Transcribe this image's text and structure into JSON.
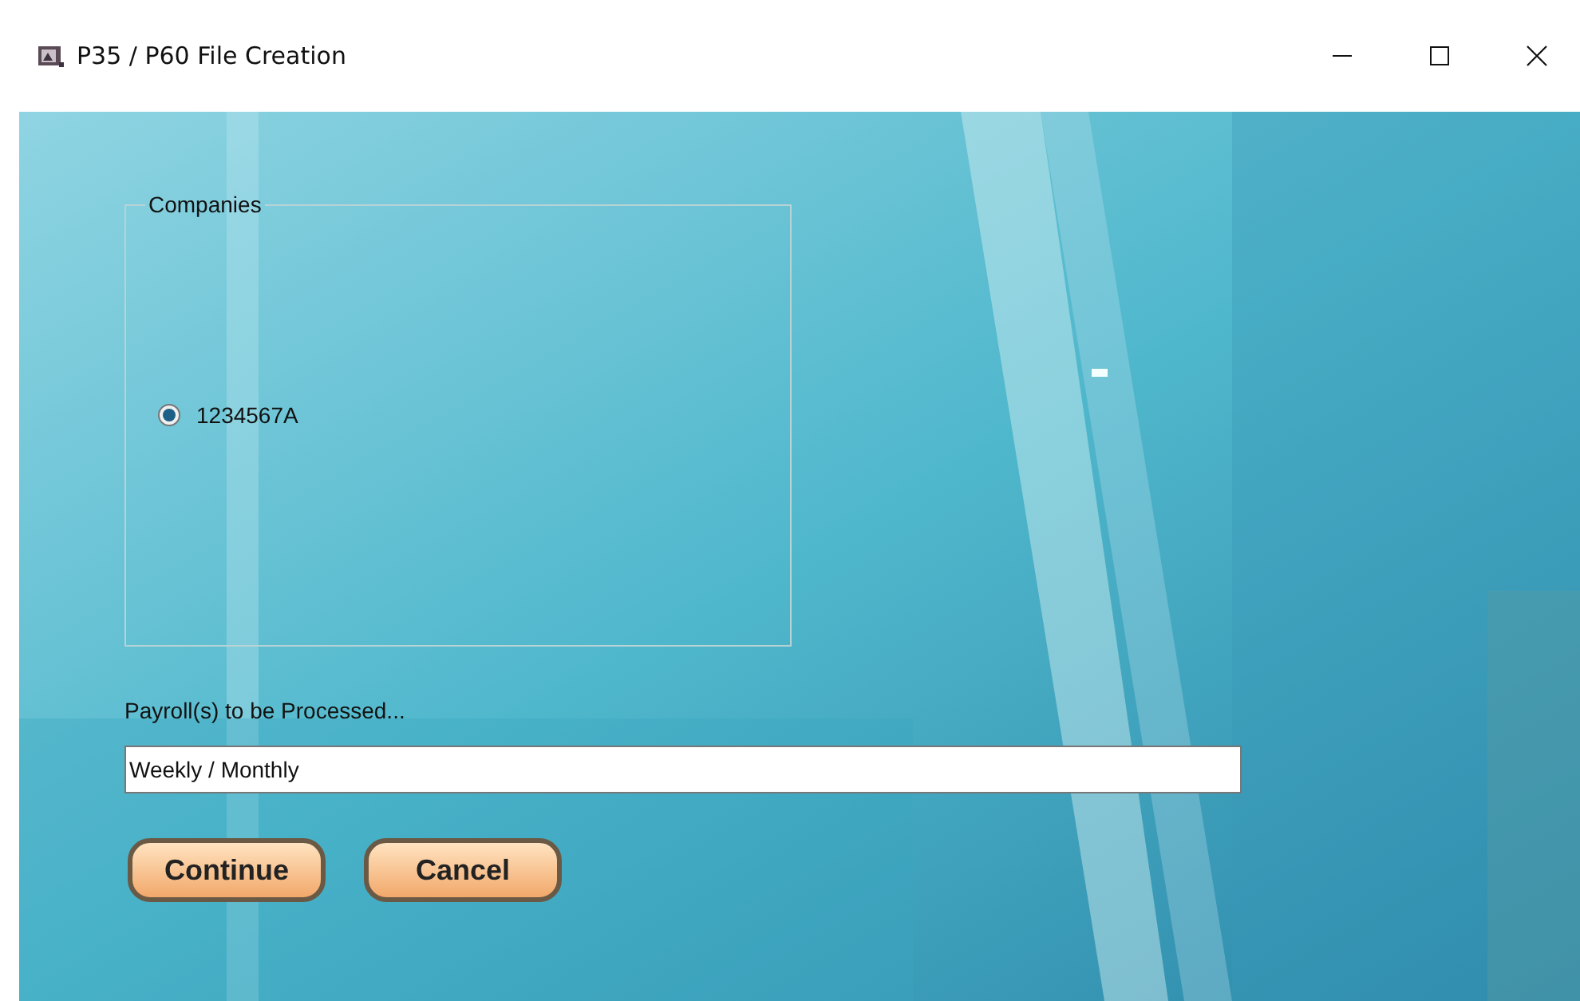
{
  "window": {
    "title": "P35 / P60 File Creation"
  },
  "companies": {
    "title": "Companies",
    "items": [
      {
        "label": "1234567A",
        "selected": true
      }
    ]
  },
  "payroll": {
    "label": "Payroll(s) to be Processed...",
    "value": "Weekly / Monthly"
  },
  "buttons": [
    "Continue",
    "Cancel"
  ]
}
